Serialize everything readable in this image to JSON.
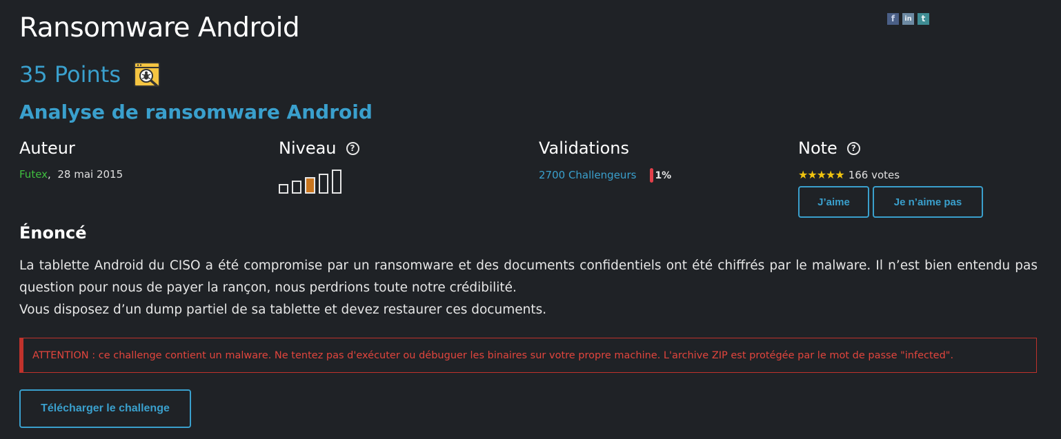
{
  "challenge": {
    "title": "Ransomware Android",
    "points": "35 Points",
    "subtitle": "Analyse de ransomware Android",
    "category_icon": "bug-magnifier-icon"
  },
  "share": {
    "icons": [
      "facebook-icon",
      "linkedin-icon",
      "twitter-icon"
    ],
    "fb": "f",
    "li": "in",
    "tw": "t"
  },
  "author": {
    "heading": "Auteur",
    "name": "Futex",
    "separator": ",",
    "date": "28 mai 2015"
  },
  "level": {
    "heading": "Niveau",
    "help": "?",
    "current": 3,
    "max": 5
  },
  "validations": {
    "heading": "Validations",
    "challengers": "2700 Challengeurs",
    "percent": "1%"
  },
  "note": {
    "heading": "Note",
    "help": "?",
    "stars": "★★★★★",
    "rating": 5,
    "votes": "166 votes",
    "like_label": "J’aime",
    "dislike_label": "Je n’aime pas"
  },
  "statement": {
    "heading": "Énoncé",
    "paragraph1": "La tablette Android du CISO a été compromise par un ransomware et des documents confidentiels ont été chiffrés par le malware. Il n’est bien entendu pas question pour nous de payer la rançon, nous perdrions toute notre crédibilité.",
    "paragraph2": "Vous disposez d’un dump partiel de sa tablette et devez restaurer ces documents."
  },
  "warning": {
    "text": "ATTENTION : ce challenge contient un malware. Ne tentez pas d'exécuter ou débuguer les binaires sur votre propre machine. L'archive ZIP est protégée par le mot de passe \"infected\"."
  },
  "download": {
    "label": "Télécharger le challenge"
  },
  "colors": {
    "background": "#1f2226",
    "accent": "#3aa0cd",
    "author": "#3fbf3f",
    "warning": "#c0322c",
    "star": "#f1c40f"
  }
}
